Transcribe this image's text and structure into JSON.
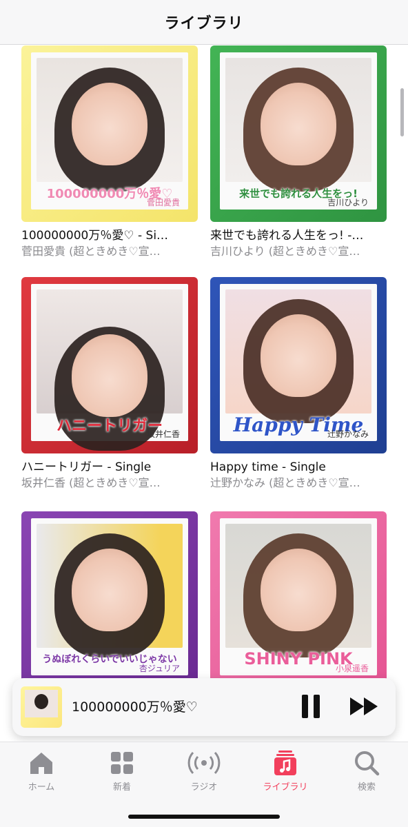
{
  "header": {
    "title": "ライブラリ"
  },
  "albums": [
    {
      "title": "100000000万％愛♡ - Si…",
      "artist": "菅田愛貴 (超ときめき♡宣…",
      "art_text": "100000000万％愛♡",
      "art_artist": "菅田愛貴",
      "frame_color": "#f8ef7a",
      "caption_color": "#f08ab3"
    },
    {
      "title": "来世でも誇れる人生をっ! -…",
      "artist": "吉川ひより (超ときめき♡宣…",
      "art_text": "来世でも誇れる人生をっ!",
      "art_artist": "吉川ひより",
      "frame_color": "#3aa84a",
      "caption_color": "#2f8f3f"
    },
    {
      "title": "ハニートリガー - Single",
      "artist": "坂井仁香 (超ときめき♡宣…",
      "art_text": "ハニートリガー",
      "art_artist": "坂井仁香",
      "frame_color": "#d62e35",
      "caption_color": "#e02a3a"
    },
    {
      "title": "Happy time - Single",
      "artist": "辻野かなみ (超ときめき♡宣…",
      "art_text": "Happy Time",
      "art_artist": "辻野かなみ",
      "frame_color": "#2849a8",
      "caption_color": "#2f55c8"
    },
    {
      "title": "",
      "artist": "",
      "art_text": "うぬぼれくらいでいいじゃない",
      "art_artist": "杏ジュリア",
      "frame_color": "#7d3aa6",
      "caption_color": "#7d3aa6"
    },
    {
      "title": "",
      "artist": "",
      "art_text": "SHINY PINK",
      "art_artist": "小泉遥香",
      "frame_color": "#ee6aa2",
      "caption_color": "#ea5e9a"
    }
  ],
  "now_playing": {
    "track": "100000000万％愛♡"
  },
  "tabs": [
    {
      "label": "ホーム",
      "icon": "home-icon"
    },
    {
      "label": "新着",
      "icon": "grid-icon"
    },
    {
      "label": "ラジオ",
      "icon": "radio-icon"
    },
    {
      "label": "ライブラリ",
      "icon": "library-icon"
    },
    {
      "label": "検索",
      "icon": "search-icon"
    }
  ],
  "colors": {
    "accent": "#f23f5c",
    "inactive": "#8e8e93"
  }
}
